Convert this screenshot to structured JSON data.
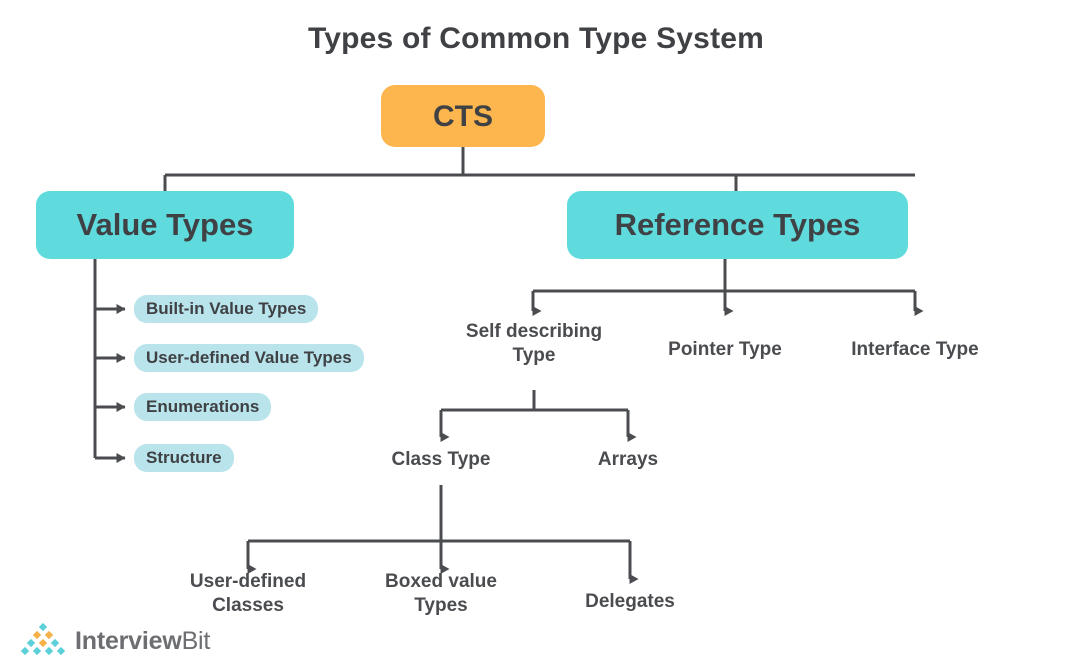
{
  "title": "Types of Common Type System",
  "colors": {
    "root_box": "#fdb64e",
    "major_box": "#5fdbdd",
    "pill": "#b9e4ec",
    "connector": "#4a4c4f",
    "text": "#3f4144",
    "logo_teal": "#5bd0d8",
    "logo_orange": "#f5b котор"
  },
  "nodes": {
    "root": {
      "label": "CTS"
    },
    "value_types": {
      "label": "Value Types"
    },
    "reference_types": {
      "label": "Reference  Types"
    }
  },
  "value_type_children": [
    {
      "label": "Built-in Value Types"
    },
    {
      "label": "User-defined Value Types"
    },
    {
      "label": "Enumerations"
    },
    {
      "label": "Structure"
    }
  ],
  "reference_type_children": [
    {
      "label": "Self describing\nType"
    },
    {
      "label": "Pointer Type"
    },
    {
      "label": "Interface Type"
    }
  ],
  "self_describing_children": [
    {
      "label": "Class Type"
    },
    {
      "label": "Arrays"
    }
  ],
  "class_type_children": [
    {
      "label": "User-defined\nClasses"
    },
    {
      "label": "Boxed value\nTypes"
    },
    {
      "label": "Delegates"
    }
  ],
  "logo": {
    "name_bold": "Interview",
    "name_light": "Bit"
  }
}
